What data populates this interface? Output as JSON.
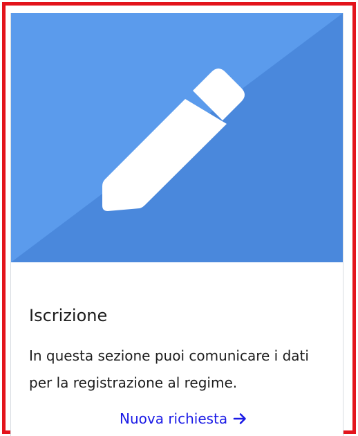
{
  "card": {
    "icon": "pencil-icon",
    "title": "Iscrizione",
    "description": "In questa sezione puoi comunicare i dati per la registrazione al regime.",
    "link_label": "Nuova richiesta",
    "link_icon": "arrow-right-icon"
  },
  "colors": {
    "frame_border": "#e3141c",
    "hero_light": "#5b9bec",
    "hero_dark": "#4a88dc",
    "link": "#1a1ae6"
  }
}
